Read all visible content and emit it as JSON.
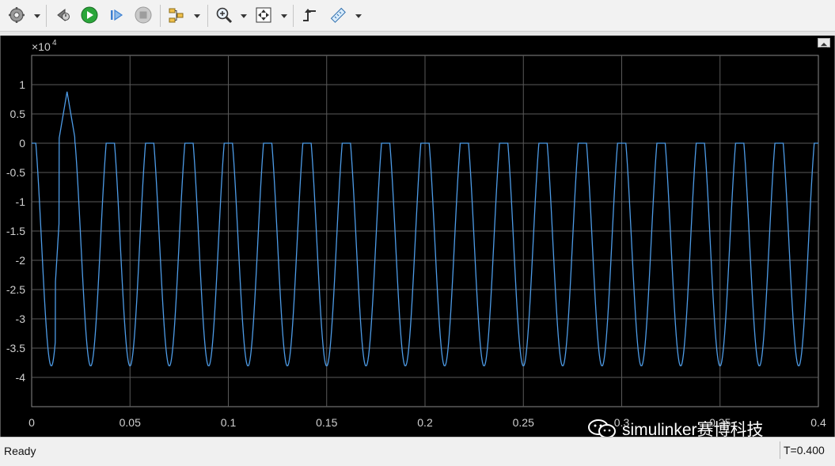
{
  "toolbar": {
    "buttons": [
      {
        "name": "settings-icon"
      },
      {
        "name": "step-back-icon"
      },
      {
        "name": "run-icon"
      },
      {
        "name": "step-forward-icon"
      },
      {
        "name": "stop-icon"
      },
      {
        "name": "highlight-model-icon"
      },
      {
        "name": "zoom-icon"
      },
      {
        "name": "autoscale-icon"
      },
      {
        "name": "triggers-icon"
      },
      {
        "name": "measurements-icon"
      }
    ]
  },
  "plot": {
    "exponent_label": "×10",
    "exponent_power": "4",
    "background": "#000000",
    "grid_color": "#5a5a5a",
    "line_color": "#4d9be6",
    "tick_color": "#d0d0d0"
  },
  "chart_data": {
    "type": "line",
    "title": "",
    "xlabel": "",
    "ylabel": "",
    "xlim": [
      0,
      0.4
    ],
    "ylim": [
      -4.5,
      1.5
    ],
    "y_multiplier": 10000,
    "x_ticks": [
      "0",
      "0.05",
      "0.1",
      "0.15",
      "0.2",
      "0.25",
      "0.3",
      "0.35",
      "0.4"
    ],
    "y_ticks": [
      "1",
      "0.5",
      "0",
      "-0.5",
      "-1",
      "-1.5",
      "-2",
      "-2.5",
      "-3",
      "-3.5",
      "-4"
    ],
    "grid": true,
    "series": [
      {
        "period": 0.02,
        "min": -3.8,
        "max": 0,
        "initial_peak": {
          "x": 0.018,
          "y": 0.88
        },
        "x": [
          0,
          0.002,
          0.005,
          0.008,
          0.01,
          0.013,
          0.016,
          0.018,
          0.02,
          0.022,
          0.025,
          0.028,
          0.03,
          0.033,
          0.036,
          0.038,
          0.04,
          0.042,
          0.045,
          0.048,
          0.05,
          0.053,
          0.056,
          0.058,
          0.06,
          0.4
        ],
        "y": [
          0,
          -0.6,
          -2.4,
          -3.7,
          -3.8,
          -3.0,
          -0.8,
          0.88,
          -0.4,
          -2.0,
          -3.6,
          -3.8,
          -3.0,
          -1.2,
          0,
          0,
          0,
          -0.8,
          -2.8,
          -3.8,
          -3.8,
          -2.8,
          -0.6,
          0,
          0,
          0
        ]
      }
    ]
  },
  "status": {
    "left": "Ready",
    "right": "T=0.400"
  },
  "watermark": {
    "text": "simulinker赛博科技"
  }
}
